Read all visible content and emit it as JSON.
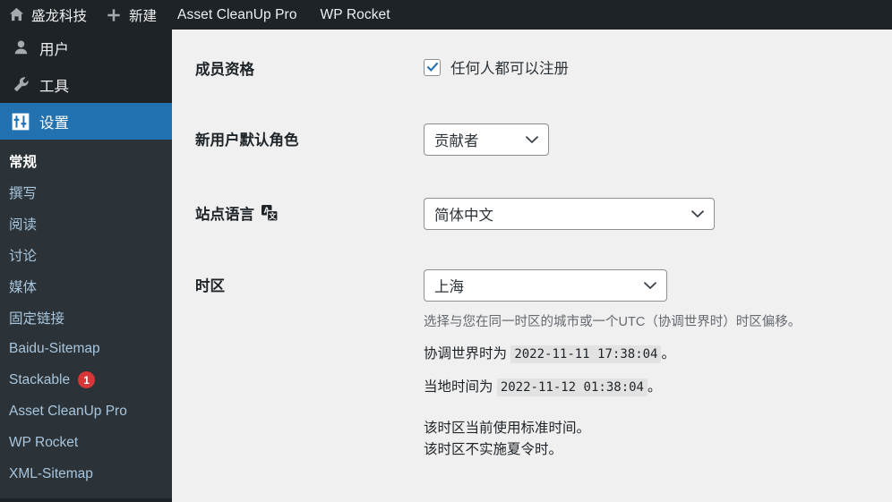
{
  "adminbar": {
    "site_icon": "home-icon",
    "site_name": "盛龙科技",
    "new_icon": "plus-icon",
    "new_label": "新建",
    "items": [
      {
        "label": "Asset CleanUp Pro"
      },
      {
        "label": "WP Rocket"
      }
    ]
  },
  "sidebar": {
    "menu": [
      {
        "label": "用户",
        "icon": "user-icon",
        "current": false
      },
      {
        "label": "工具",
        "icon": "wrench-icon",
        "current": false
      },
      {
        "label": "设置",
        "icon": "settings-sliders-icon",
        "current": true
      }
    ],
    "submenu": [
      {
        "label": "常规",
        "current": true,
        "badge": ""
      },
      {
        "label": "撰写",
        "current": false,
        "badge": ""
      },
      {
        "label": "阅读",
        "current": false,
        "badge": ""
      },
      {
        "label": "讨论",
        "current": false,
        "badge": ""
      },
      {
        "label": "媒体",
        "current": false,
        "badge": ""
      },
      {
        "label": "固定链接",
        "current": false,
        "badge": ""
      },
      {
        "label": "Baidu-Sitemap",
        "current": false,
        "badge": ""
      },
      {
        "label": "Stackable",
        "current": false,
        "badge": "1"
      },
      {
        "label": "Asset CleanUp Pro",
        "current": false,
        "badge": ""
      },
      {
        "label": "WP Rocket",
        "current": false,
        "badge": ""
      },
      {
        "label": "XML-Sitemap",
        "current": false,
        "badge": ""
      }
    ]
  },
  "settings": {
    "membership": {
      "label": "成员资格",
      "checkbox_label": "任何人都可以注册",
      "checked": true
    },
    "default_role": {
      "label": "新用户默认角色",
      "value": "贡献者"
    },
    "site_language": {
      "label": "站点语言",
      "icon": "translation-icon",
      "value": "简体中文"
    },
    "timezone": {
      "label": "时区",
      "value": "上海",
      "description": "选择与您在同一时区的城市或一个UTC（协调世界时）时区偏移。",
      "utc_prefix": "协调世界时为",
      "utc_time": "2022-11-11 17:38:04",
      "utc_suffix": "。",
      "local_prefix": "当地时间为",
      "local_time": "2022-11-12 01:38:04",
      "local_suffix": "。",
      "note_standard": "该时区当前使用标准时间。",
      "note_dst": "该时区不实施夏令时。"
    }
  },
  "colors": {
    "admin_dark": "#1d2327",
    "submenu_dark": "#2c3338",
    "accent_blue": "#2271b1",
    "badge_red": "#d63638",
    "content_bg": "#f0f0f1"
  }
}
